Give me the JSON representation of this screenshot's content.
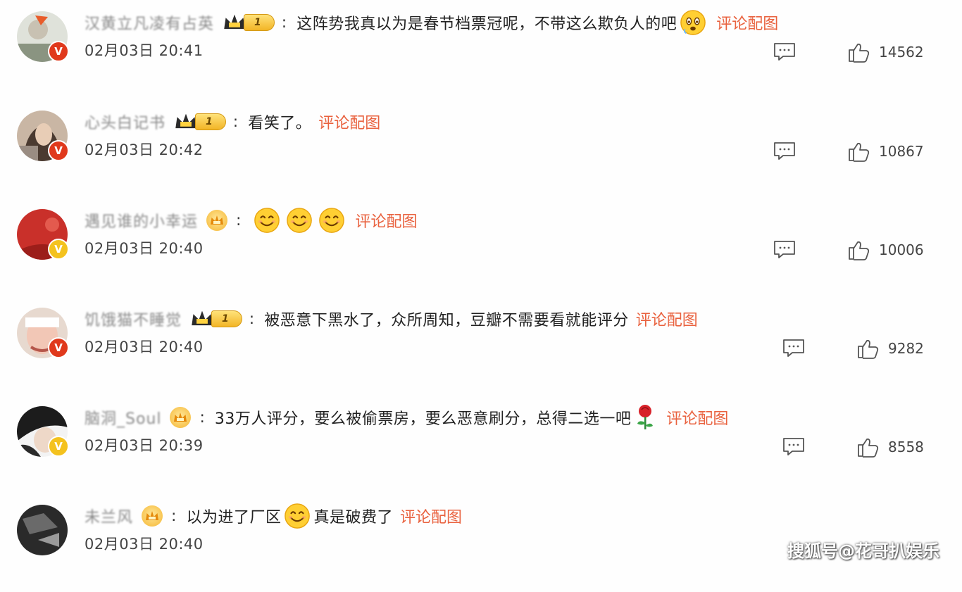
{
  "comments": [
    {
      "username": "汉黄立凡凌有占英",
      "badge_level": "1",
      "text": "这阵势我真以为是春节档票冠呢，不带这么欺负人的吧",
      "emojis_after": 1,
      "pic_link": "评论配图",
      "time": "02月03日 20:41",
      "likes": "14562",
      "verify_color": "red"
    },
    {
      "username": "心头白记书",
      "badge_level": "1",
      "text": "看笑了。",
      "emojis_after": 0,
      "pic_link": "评论配图",
      "time": "02月03日 20:42",
      "likes": "10867",
      "verify_color": "red"
    },
    {
      "username": "遇见谁的小幸运",
      "badge_level": "",
      "text": "",
      "emojis_after": 3,
      "pic_link": "评论配图",
      "time": "02月03日 20:40",
      "likes": "10006",
      "verify_color": "yellow"
    },
    {
      "username": "饥饿猫不睡觉",
      "badge_level": "1",
      "text": "被恶意下黑水了，众所周知，豆瓣不需要看就能评分",
      "emojis_after": 0,
      "pic_link": "评论配图",
      "time": "02月03日 20:40",
      "likes": "9282",
      "verify_color": "red"
    },
    {
      "username": "脑洞_Soul",
      "badge_level": "",
      "text": "33万人评分，要么被偷票房，要么恶意刷分，总得二选一吧",
      "emojis_after": 0,
      "has_rose": true,
      "pic_link": "评论配图",
      "time": "02月03日 20:39",
      "likes": "8558",
      "verify_color": "yellow"
    },
    {
      "username": "未兰风",
      "badge_level": "",
      "text": "以为进了厂区",
      "text_after": "真是破费了",
      "emojis_after": 0,
      "pic_link": "评论配图",
      "time": "02月03日 20:40",
      "likes": "",
      "verify_color": "none"
    }
  ],
  "watermark": "搜狐号@花哥扒娱乐",
  "colors": {
    "link": "#e9623f",
    "verify_red": "#e0391c",
    "verify_yellow": "#f4c21e"
  },
  "icons": [
    "comment-icon",
    "like-icon",
    "crown-icon",
    "smile-emoji-icon",
    "worried-emoji-icon",
    "rose-icon"
  ]
}
